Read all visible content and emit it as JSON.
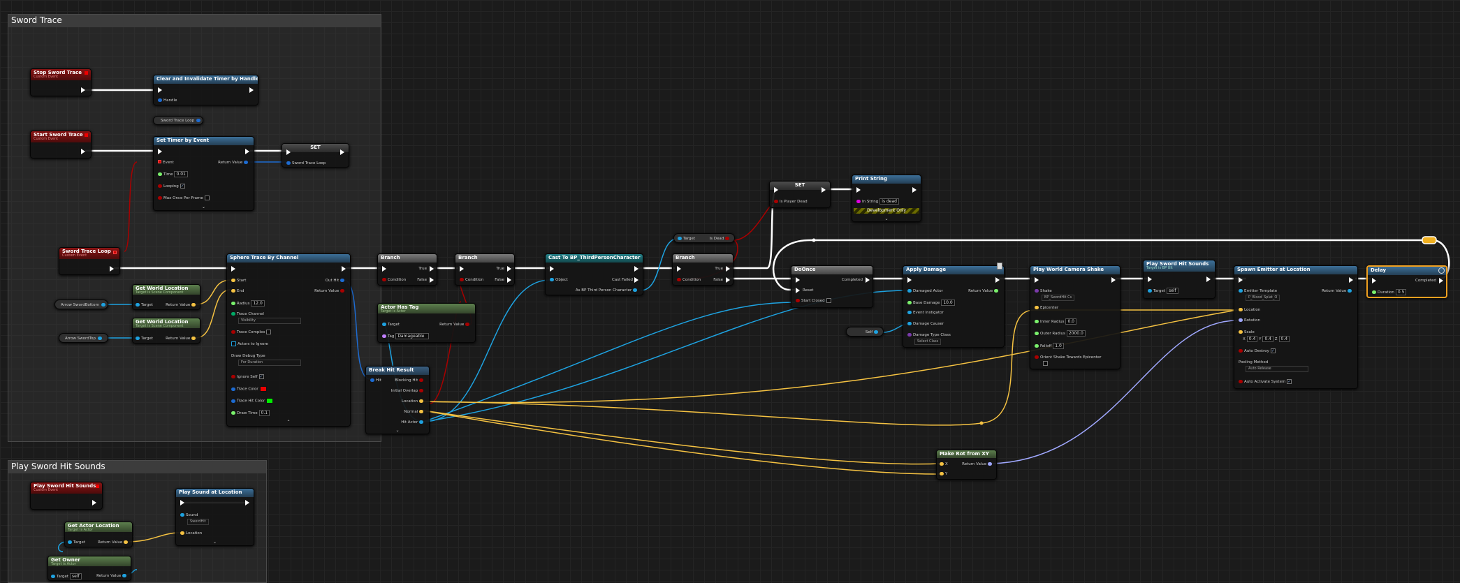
{
  "comments": {
    "sword_trace": "Sword Trace",
    "play_hit_sounds": "Play Sword Hit Sounds"
  },
  "colors": {
    "exec": "#ffffff",
    "object": "#1ea2e0",
    "boolean": "#a80000",
    "vector": "#f5c242",
    "rotator": "#a0a8ff",
    "string": "#e000e0",
    "struct": "#1d6bd1",
    "float": "#7af06c"
  },
  "nodes": {
    "stop_trace": {
      "title": "Stop Sword Trace",
      "sub": "Custom Event"
    },
    "clear_timer": {
      "title": "Clear and Invalidate Timer by Handle",
      "handle": "Handle"
    },
    "trace_loop_var": {
      "title": "Sword Trace Loop"
    },
    "start_trace": {
      "title": "Start Sword Trace",
      "sub": "Custom Event"
    },
    "set_timer": {
      "title": "Set Timer by Event",
      "event": "Event",
      "return": "Return Value",
      "time": "Time",
      "time_val": "0.01",
      "looping": "Looping",
      "max_once": "Max Once Per Frame"
    },
    "set_loop": {
      "title": "SET",
      "pin": "Sword Trace Loop"
    },
    "trace_loop_ev": {
      "title": "Sword Trace Loop",
      "sub": "Custom Event"
    },
    "sphere_trace": {
      "title": "Sphere Trace By Channel",
      "start": "Start",
      "end": "End",
      "out_hit": "Out Hit",
      "return": "Return Value",
      "radius": "Radius",
      "radius_val": "12.0",
      "channel": "Trace Channel",
      "channel_val": "Visibility",
      "complex": "Trace Complex",
      "actors_ignore": "Actors to Ignore",
      "debug": "Draw Debug Type",
      "debug_val": "For Duration",
      "ignore_self": "Ignore Self",
      "trace_color": "Trace Color",
      "hit_color": "Trace Hit Color",
      "draw_time": "Draw Time",
      "draw_time_val": "0.1"
    },
    "gwl1": {
      "title": "Get World Location",
      "sub": "Target is Scene Component",
      "target": "Target",
      "return": "Return Value"
    },
    "gwl2": {
      "title": "Get World Location",
      "sub": "Target is Scene Component",
      "target": "Target",
      "return": "Return Value"
    },
    "arrow_bottom": {
      "label": "Arrow SwordBottom"
    },
    "arrow_top": {
      "label": "Arrow SwordTop"
    },
    "branch1": {
      "title": "Branch",
      "condition": "Condition",
      "true": "True",
      "false": "False"
    },
    "branch2": {
      "title": "Branch",
      "condition": "Condition",
      "true": "True",
      "false": "False"
    },
    "actor_has_tag": {
      "title": "Actor Has Tag",
      "sub": "Target is Actor",
      "target": "Target",
      "return": "Return Value",
      "tag": "Tag",
      "tag_val": "Damageable"
    },
    "break_hit": {
      "title": "Break Hit Result",
      "hit": "Hit",
      "blocking": "Blocking Hit",
      "initial": "Initial Overlap",
      "location": "Location",
      "normal": "Normal",
      "hit_actor": "Hit Actor"
    },
    "cast": {
      "title": "Cast To BP_ThirdPersonCharacter",
      "object": "Object",
      "cast_failed": "Cast Failed",
      "as": "As BP Third Person Character"
    },
    "target_isdead": {
      "target": "Target",
      "is_dead": "Is Dead"
    },
    "branch3": {
      "title": "Branch",
      "condition": "Condition",
      "true": "True",
      "false": "False"
    },
    "set_dead": {
      "title": "SET",
      "pin": "Is Player Dead"
    },
    "print": {
      "title": "Print String",
      "in_string": "In String",
      "in_string_val": "is dead",
      "dev": "Development Only"
    },
    "do_once": {
      "title": "DoOnce",
      "completed": "Completed",
      "reset": "Reset",
      "start_closed": "Start Closed"
    },
    "apply_damage": {
      "title": "Apply Damage",
      "damaged": "Damaged Actor",
      "return": "Return Value",
      "base": "Base Damage",
      "base_val": "10.0",
      "instigator": "Event Instigator",
      "causer": "Damage Causer",
      "type": "Damage Type Class",
      "type_val": "Select Class"
    },
    "self_node": {
      "label": "Self"
    },
    "camera_shake": {
      "title": "Play World Camera Shake",
      "shake": "Shake",
      "shake_val": "BP_SwordHit Cs",
      "epicenter": "Epicenter",
      "inner": "Inner Radius",
      "inner_val": "0.0",
      "outer": "Outer Radius",
      "outer_val": "2000.0",
      "falloff": "Falloff",
      "falloff_val": "1.0",
      "orient": "Orient Shake Towards Epicenter"
    },
    "play_hit_call": {
      "title": "Play Sword Hit Sounds",
      "sub": "Target is BP Ult",
      "target": "Target",
      "target_val": "self"
    },
    "spawn_emitter": {
      "title": "Spawn Emitter at Location",
      "template": "Emitter Template",
      "template_val": "P_Blood_Splat_O",
      "return": "Return Value",
      "location": "Location",
      "rotation": "Rotation",
      "scale": "Scale",
      "sx": "0.4",
      "sy": "0.4",
      "sz": "0.4",
      "auto_destroy": "Auto Destroy",
      "pooling": "Pooling Method",
      "pooling_val": "Auto Release",
      "auto_activate": "Auto Activate System"
    },
    "delay": {
      "title": "Delay",
      "completed": "Completed",
      "duration": "Duration",
      "duration_val": "0.5"
    },
    "make_rot": {
      "title": "Make Rot from XY",
      "x": "X",
      "y": "Y",
      "return": "Return Value"
    },
    "hit_sounds_ev": {
      "title": "Play Sword Hit Sounds",
      "sub": "Custom Event"
    },
    "play_sound": {
      "title": "Play Sound at Location",
      "sound": "Sound",
      "sound_val": "SwordHit",
      "location": "Location"
    },
    "get_actor_loc": {
      "title": "Get Actor Location",
      "sub": "Target is Actor",
      "target": "Target",
      "return": "Return Value"
    },
    "get_owner": {
      "title": "Get Owner",
      "sub": "Target is Actor",
      "target": "Target",
      "target_val": "self",
      "return": "Return Value"
    }
  }
}
